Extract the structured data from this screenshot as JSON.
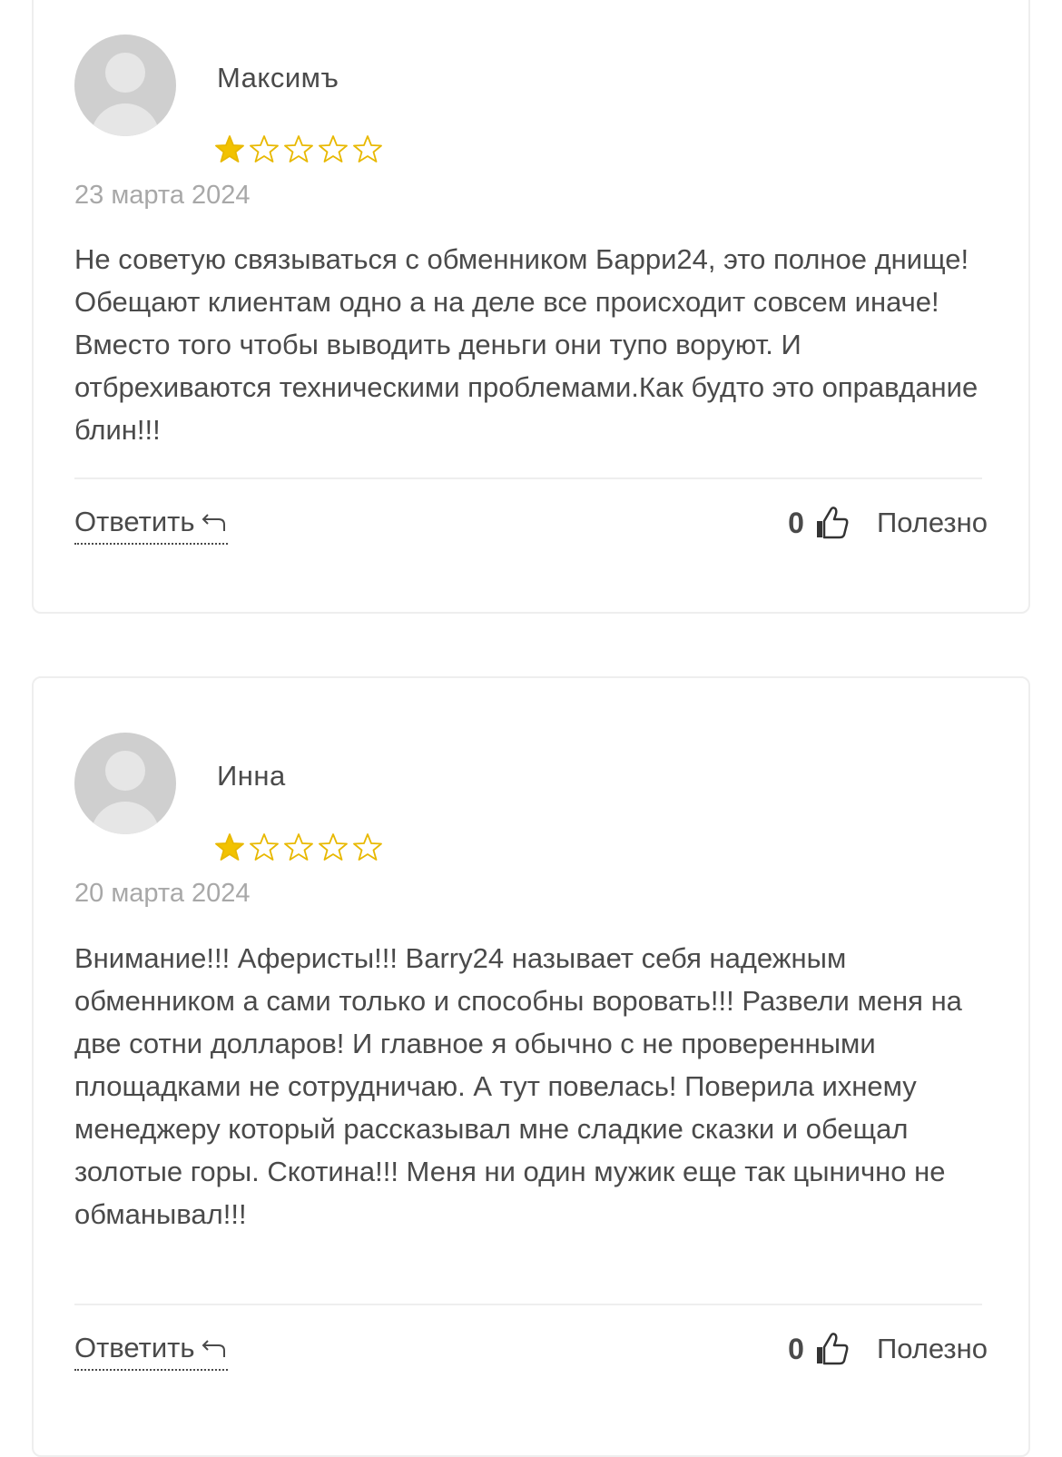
{
  "reviews": [
    {
      "author": "Максимъ",
      "rating": 1,
      "max_rating": 5,
      "date": "23 марта 2024",
      "text": "Не советую связываться с обменником Барри24, это полное днище! Обещают клиентам одно а на деле все происходит совсем иначе! Вместо того чтобы выводить деньги они тупо воруют. И отбрехиваются техническими проблемами.Как будто это оправдание блин!!!",
      "reply_label": "Ответить",
      "helpful_count": "0",
      "helpful_label": "Полезно"
    },
    {
      "author": "Инна",
      "rating": 1,
      "max_rating": 5,
      "date": "20 марта 2024",
      "text": "Внимание!!! Аферисты!!! Barry24 называет себя надежным обменником а сами только и способны воровать!!! Развели меня на две сотни долларов! И главное я обычно с не проверенными площадками не сотрудничаю. А тут повелась! Поверила ихнему менеджеру который рассказывал мне сладкие сказки и обещал золотые горы. Скотина!!! Меня ни один мужик еще так цынично не обманывал!!!",
      "reply_label": "Ответить",
      "helpful_count": "0",
      "helpful_label": "Полезно"
    }
  ],
  "colors": {
    "star_filled": "#f2c200",
    "star_outline": "#e8b800",
    "text": "#4a4a4a",
    "date": "#a8a8a8",
    "border": "#eeeeee",
    "avatar_bg": "#cfcfcf"
  },
  "icons": {
    "star": "star-icon",
    "reply": "reply-arrow-icon",
    "thumb": "thumbs-up-icon",
    "avatar": "user-avatar-icon"
  }
}
